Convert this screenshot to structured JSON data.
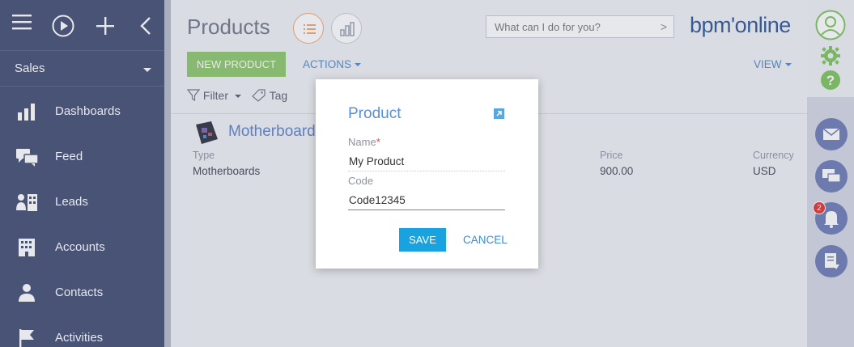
{
  "sidebar": {
    "section_label": "Sales",
    "items": [
      {
        "label": "Dashboards"
      },
      {
        "label": "Feed"
      },
      {
        "label": "Leads"
      },
      {
        "label": "Accounts"
      },
      {
        "label": "Contacts"
      },
      {
        "label": "Activities"
      }
    ]
  },
  "header": {
    "title": "Products",
    "search_placeholder": "What can I do for you?",
    "logo_text": "bpm'online"
  },
  "toolbar": {
    "new_label": "NEW PRODUCT",
    "actions_label": "ACTIONS",
    "view_label": "VIEW",
    "filter_label": "Filter",
    "tag_label": "Tag"
  },
  "record": {
    "name": "Motherboards",
    "columns": [
      {
        "label": "Type",
        "value": "Motherboards"
      },
      {
        "label": "Price",
        "value": "900.00"
      },
      {
        "label": "Currency",
        "value": "USD"
      }
    ]
  },
  "rightbar": {
    "notification_count": "2"
  },
  "modal": {
    "title": "Product",
    "name_label": "Name",
    "required_mark": "*",
    "name_value": "My Product",
    "code_label": "Code",
    "code_value": "Code12345",
    "save_label": "SAVE",
    "cancel_label": "CANCEL"
  },
  "colors": {
    "sidebar_bg": "#3e4a70",
    "accent_green": "#8cc66a",
    "link_blue": "#4d88c7",
    "save_blue": "#18a2e0",
    "badge_red": "#e12e2e"
  }
}
